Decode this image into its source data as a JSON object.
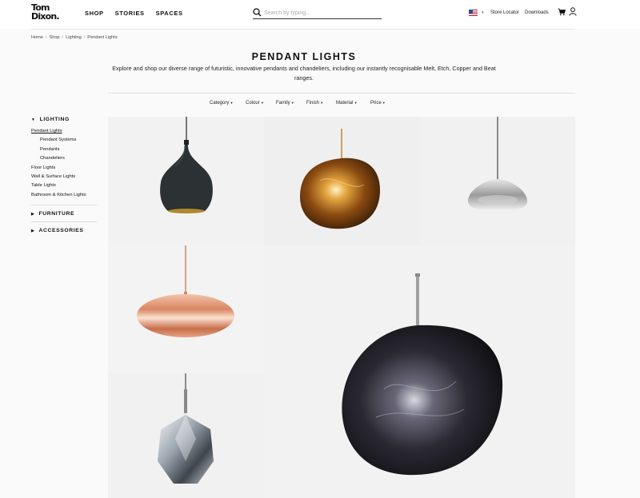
{
  "header": {
    "logo_line1": "Tom",
    "logo_line2": "Dixon.",
    "nav": [
      "SHOP",
      "STORIES",
      "SPACES"
    ],
    "search_placeholder": "Search by typing...",
    "store_locator": "Store Locator",
    "downloads": "Downloads"
  },
  "breadcrumb": [
    "Home",
    "Shop",
    "Lighting",
    "Pendant Lights"
  ],
  "page": {
    "title": "PENDANT LIGHTS",
    "intro": "Explore and shop our diverse range of futuristic, innovative pendants and chandeliers, including our instantly recognisable Melt, Etch, Copper and Beat ranges."
  },
  "filters": [
    "Category",
    "Colour",
    "Family",
    "Finish",
    "Material",
    "Price"
  ],
  "sidebar": {
    "lighting": {
      "label": "LIGHTING",
      "items": [
        {
          "label": "Pendant Lights",
          "indent": false,
          "active": true
        },
        {
          "label": "Pendant Systems",
          "indent": true,
          "active": false
        },
        {
          "label": "Pendants",
          "indent": true,
          "active": false
        },
        {
          "label": "Chandeliers",
          "indent": true,
          "active": false
        },
        {
          "label": "Floor Lights",
          "indent": false,
          "active": false
        },
        {
          "label": "Wall & Surface Lights",
          "indent": false,
          "active": false
        },
        {
          "label": "Table Lights",
          "indent": false,
          "active": false
        },
        {
          "label": "Bathroom & Kitchen Lights",
          "indent": false,
          "active": false
        }
      ]
    },
    "furniture": "FURNITURE",
    "accessories": "ACCESSORIES"
  },
  "products": [
    {
      "name": "beat-pendant",
      "bg": "#f2f2f2"
    },
    {
      "name": "melt-gold-pendant",
      "bg": "#efefef"
    },
    {
      "name": "void-chrome-pendant",
      "bg": "#f1f1f1"
    },
    {
      "name": "copper-wide-pendant",
      "bg": "#f3f3f3"
    },
    {
      "name": "melt-smoke-pendant",
      "bg": "#f2f2f2"
    },
    {
      "name": "cut-pendant",
      "bg": "#f1f1f1"
    }
  ],
  "colors": {
    "beat": "#2b2f30",
    "copper": "#d89a7a",
    "gold": "#c98a2a",
    "smoke": "#28262e"
  }
}
